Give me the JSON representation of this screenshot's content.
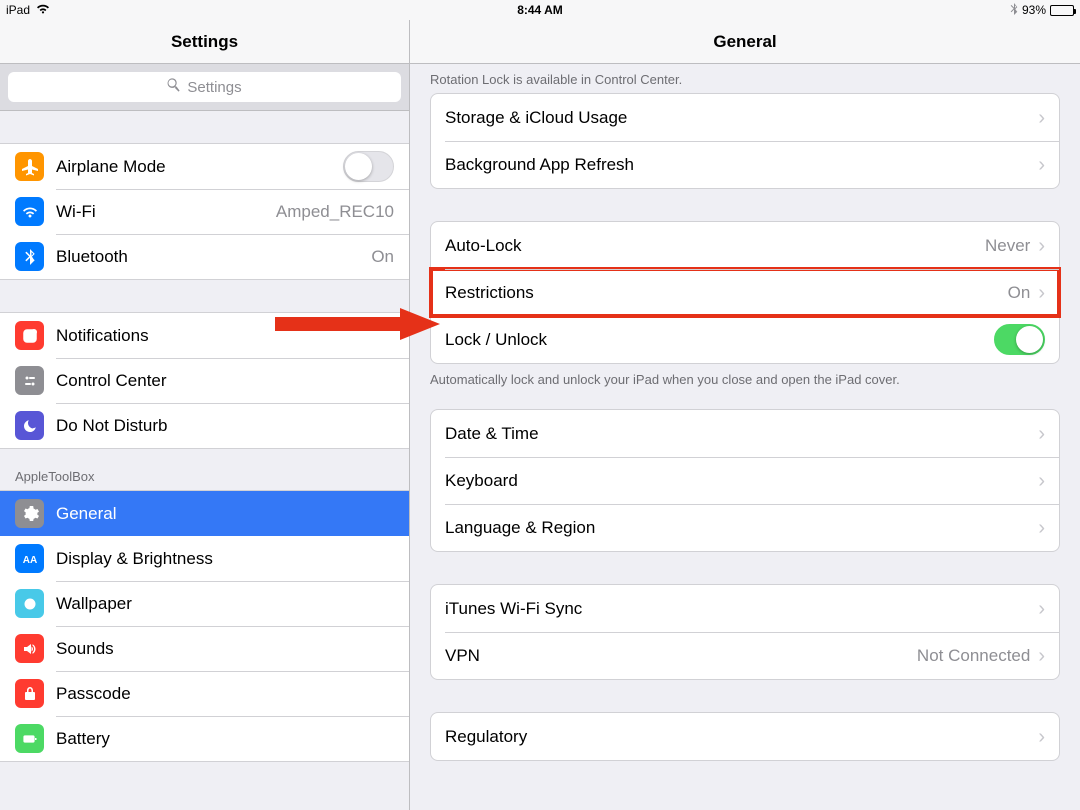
{
  "status": {
    "device": "iPad",
    "time": "8:44 AM",
    "battery_pct": "93%"
  },
  "sidebar": {
    "title": "Settings",
    "search_placeholder": "Settings",
    "groups": [
      {
        "rows": [
          {
            "id": "airplane",
            "label": "Airplane Mode",
            "icon_color": "#ff9500",
            "value": "",
            "has_switch": true,
            "switch_on": false,
            "selected": false
          },
          {
            "id": "wifi",
            "label": "Wi-Fi",
            "icon_color": "#007aff",
            "value": "Amped_REC10",
            "selected": false
          },
          {
            "id": "bluetooth",
            "label": "Bluetooth",
            "icon_color": "#007aff",
            "value": "On",
            "selected": false
          }
        ]
      },
      {
        "rows": [
          {
            "id": "notifications",
            "label": "Notifications",
            "icon_color": "#ff3b30",
            "selected": false
          },
          {
            "id": "controlcenter",
            "label": "Control Center",
            "icon_color": "#8e8e93",
            "selected": false
          },
          {
            "id": "dnd",
            "label": "Do Not Disturb",
            "icon_color": "#5856d6",
            "selected": false
          }
        ]
      },
      {
        "header": "AppleToolBox",
        "rows": [
          {
            "id": "general",
            "label": "General",
            "icon_color": "#8e8e93",
            "selected": true
          },
          {
            "id": "display",
            "label": "Display & Brightness",
            "icon_color": "#007aff",
            "selected": false
          },
          {
            "id": "wallpaper",
            "label": "Wallpaper",
            "icon_color": "#48c9e8",
            "selected": false
          },
          {
            "id": "sounds",
            "label": "Sounds",
            "icon_color": "#ff3b30",
            "selected": false
          },
          {
            "id": "passcode",
            "label": "Passcode",
            "icon_color": "#ff3b30",
            "selected": false
          },
          {
            "id": "battery",
            "label": "Battery",
            "icon_color": "#4cd964",
            "selected": false
          }
        ]
      }
    ]
  },
  "detail": {
    "title": "General",
    "top_note": "Rotation Lock is available in Control Center.",
    "group1": {
      "storage": "Storage & iCloud Usage",
      "bgrefresh": "Background App Refresh"
    },
    "group2": {
      "autolock_label": "Auto-Lock",
      "autolock_value": "Never",
      "restrictions_label": "Restrictions",
      "restrictions_value": "On",
      "lockunlock_label": "Lock / Unlock",
      "lockunlock_on": true
    },
    "lock_note": "Automatically lock and unlock your iPad when you close and open the iPad cover.",
    "group3": {
      "datetime": "Date & Time",
      "keyboard": "Keyboard",
      "langregion": "Language & Region"
    },
    "group4": {
      "itunes": "iTunes Wi-Fi Sync",
      "vpn_label": "VPN",
      "vpn_value": "Not Connected"
    },
    "group5": {
      "regulatory": "Regulatory"
    }
  },
  "annotation": {
    "arrow_color": "#e53118"
  }
}
